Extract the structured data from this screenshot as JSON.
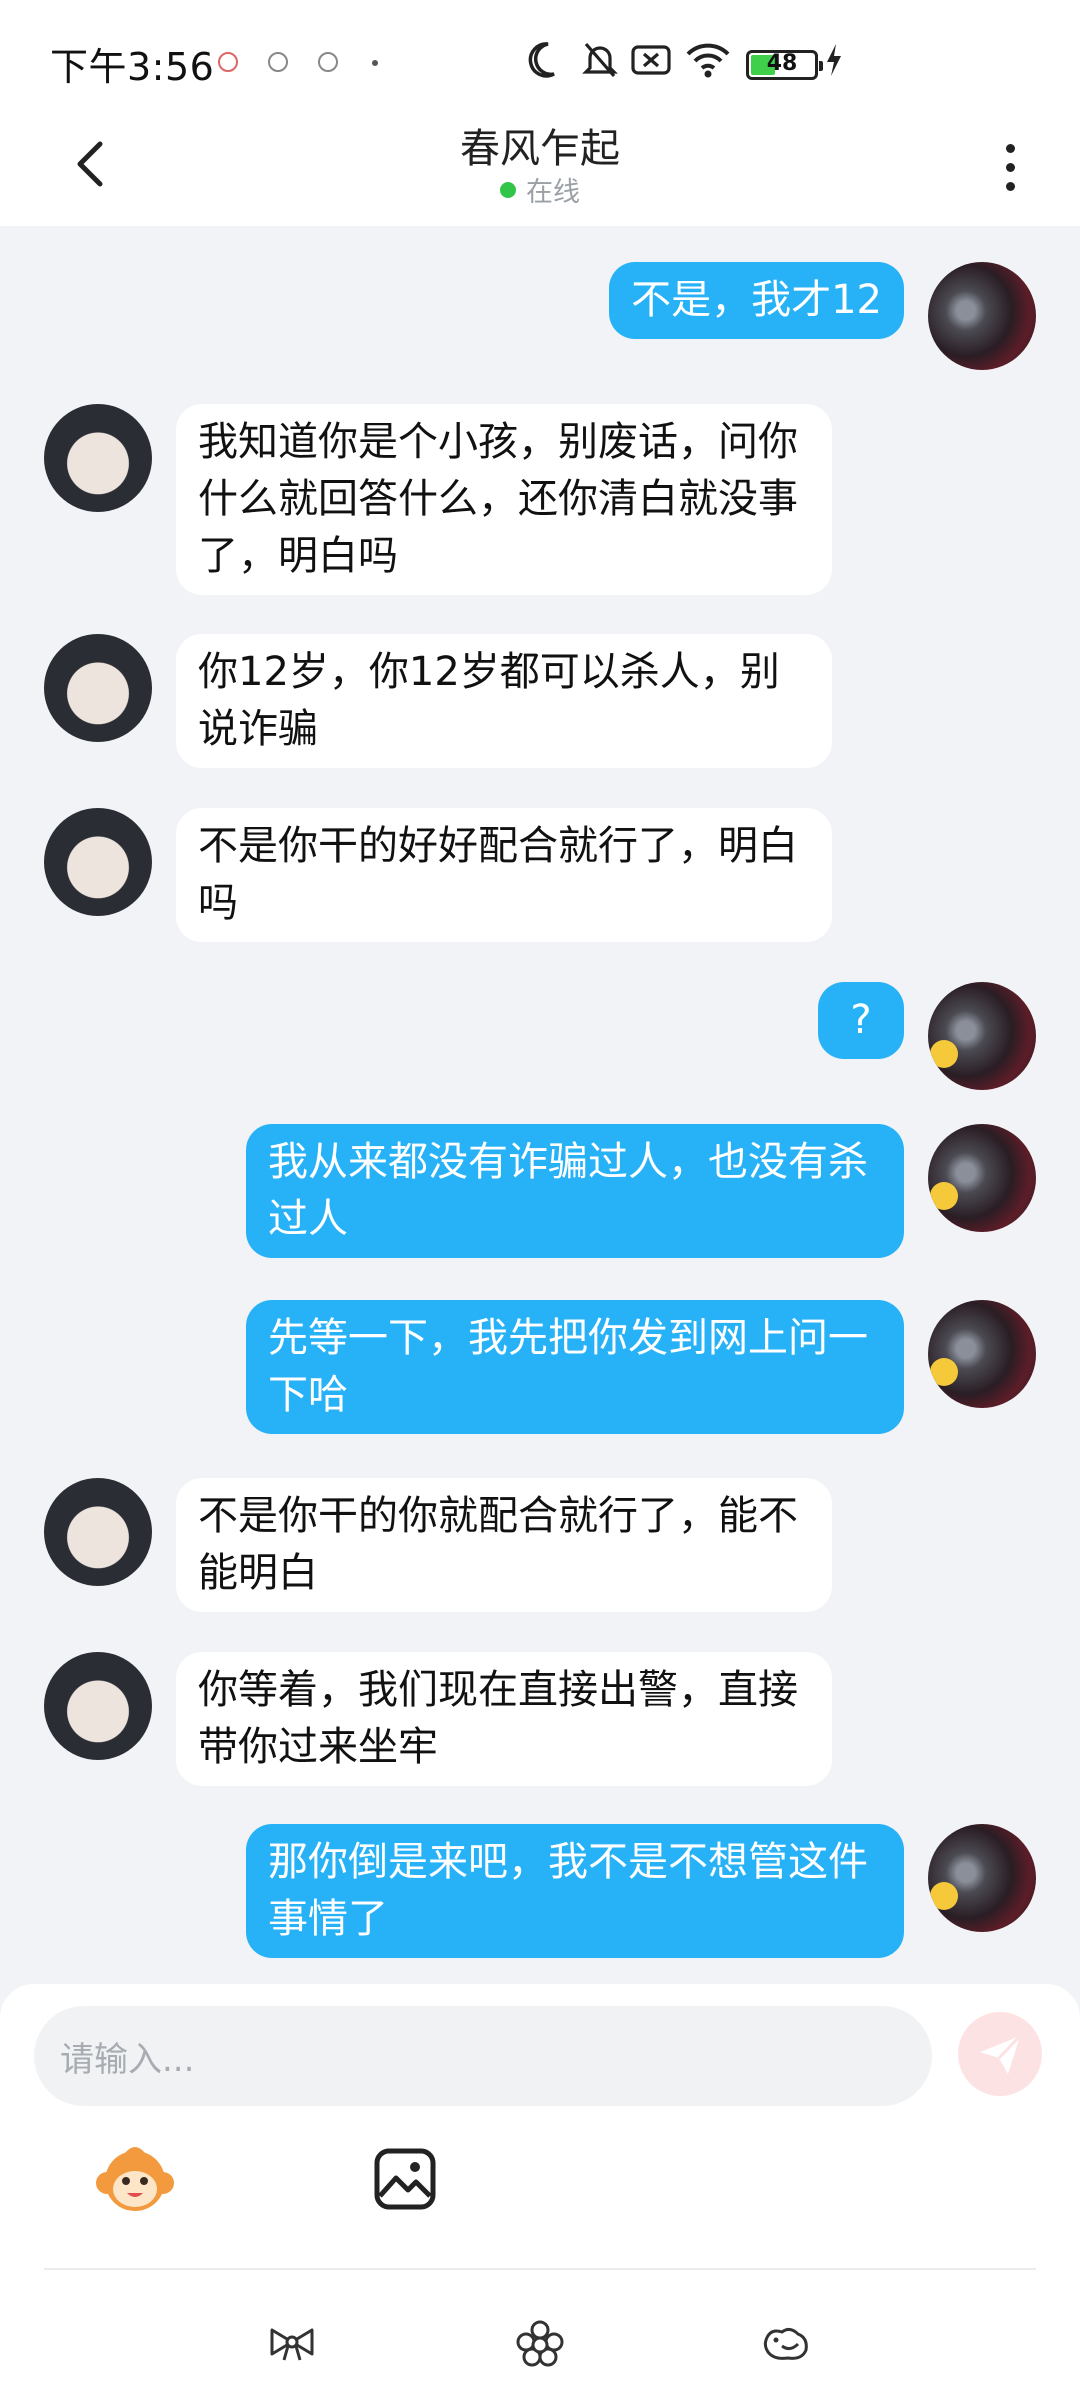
{
  "status_bar": {
    "time": "下午3:56",
    "battery": "48",
    "icons": [
      "moon-icon",
      "mute-bell-icon",
      "sim-x-icon",
      "wifi-icon",
      "battery-icon",
      "charging-icon"
    ]
  },
  "header": {
    "title": "春风乍起",
    "status": "在线",
    "status_color": "#33c549"
  },
  "messages": [
    {
      "side": "right",
      "text": "不是，我才12"
    },
    {
      "side": "left",
      "text": "我知道你是个小孩，别废话，问你什么就回答什么，还你清白就没事了，明白吗"
    },
    {
      "side": "left",
      "text": "你12岁，你12岁都可以杀人，别说诈骗"
    },
    {
      "side": "left",
      "text": "不是你干的好好配合就行了，明白吗"
    },
    {
      "side": "right",
      "text": "?"
    },
    {
      "side": "right",
      "text": "我从来都没有诈骗过人，也没有杀过人"
    },
    {
      "side": "right",
      "text": "先等一下，我先把你发到网上问一下哈"
    },
    {
      "side": "left",
      "text": "不是你干的你就配合就行了，能不能明白"
    },
    {
      "side": "left",
      "text": "你等着，我们现在直接出警，直接带你过来坐牢"
    },
    {
      "side": "right",
      "text": "那你倒是来吧，我不是不想管这件事情了"
    }
  ],
  "composer": {
    "placeholder": "请输入..."
  },
  "colors": {
    "sent_bubble": "#27b2f7",
    "received_bubble": "#ffffff",
    "chat_background": "#f1f3f6"
  }
}
